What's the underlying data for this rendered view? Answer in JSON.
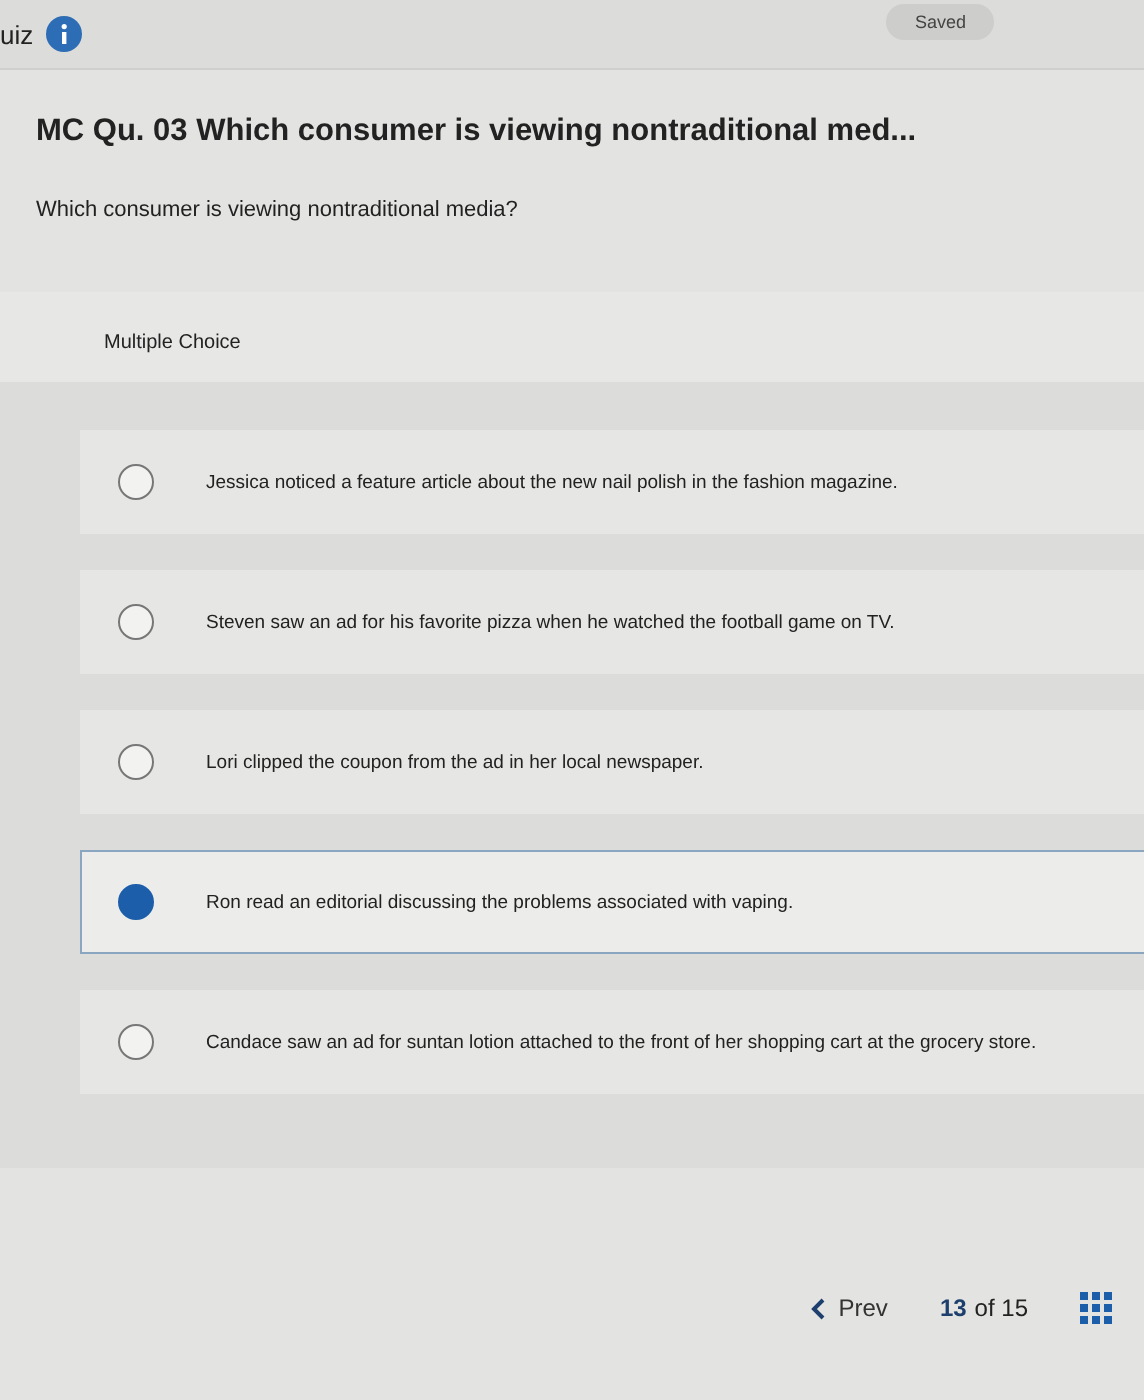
{
  "header": {
    "title": "uiz",
    "status": "Saved"
  },
  "question": {
    "title": "MC Qu. 03 Which consumer is viewing nontraditional med...",
    "prompt": "Which consumer is viewing nontraditional media?"
  },
  "panel": {
    "label": "Multiple Choice",
    "options": [
      {
        "text": "Jessica noticed a feature article about the new nail polish in the fashion magazine.",
        "selected": false
      },
      {
        "text": "Steven saw an ad for his favorite pizza when he watched the football game on TV.",
        "selected": false
      },
      {
        "text": "Lori clipped the coupon from the ad in her local newspaper.",
        "selected": false
      },
      {
        "text": "Ron read an editorial discussing the problems associated with vaping.",
        "selected": true
      },
      {
        "text": "Candace saw an ad for suntan lotion attached to the front of her shopping cart at the grocery store.",
        "selected": false
      }
    ]
  },
  "footer": {
    "prev": "Prev",
    "current": "13",
    "total": "of 15"
  }
}
